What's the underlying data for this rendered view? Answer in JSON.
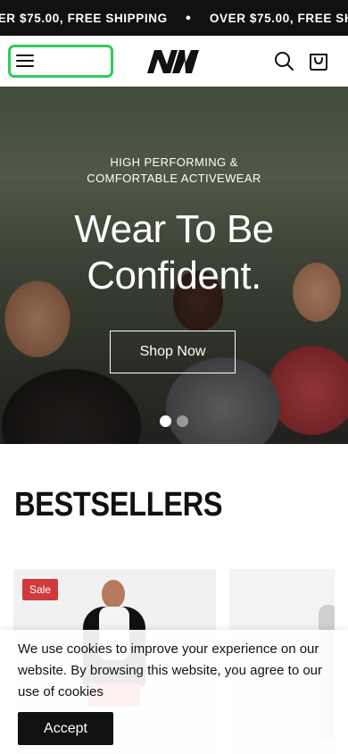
{
  "announcement": {
    "items": [
      "OVER $75.00, FREE SHIPPING",
      "OVER $75.00, FREE SHIPPING"
    ],
    "separator": "●"
  },
  "header": {
    "menu_icon": "hamburger-menu-icon",
    "logo_text": "NW",
    "search_icon": "search-icon",
    "cart_icon": "shopping-bag-icon",
    "menu_highlight_color": "#2ecc5a"
  },
  "hero": {
    "eyebrow_line1": "HIGH PERFORMING &",
    "eyebrow_line2": "COMFORTABLE ACTIVEWEAR",
    "title_line1": "Wear To Be",
    "title_line2": "Confident.",
    "cta_label": "Shop Now",
    "slides": 2,
    "active_slide": 1
  },
  "bestsellers": {
    "title": "BESTSELLERS",
    "products": [
      {
        "badge": "Sale"
      },
      {
        "badge": ""
      }
    ],
    "sale_color": "#d13a3a"
  },
  "cookie_banner": {
    "text": "We use cookies to improve your experience on our website. By browsing this website, you agree to our use of cookies",
    "accept_label": "Accept"
  }
}
